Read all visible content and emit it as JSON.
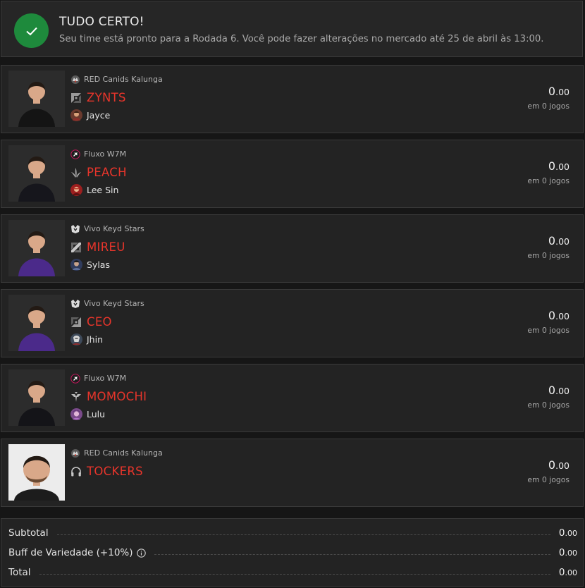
{
  "banner": {
    "title": "TUDO CERTO!",
    "message": "Seu time está pronto para a Rodada 6. Você pode fazer alterações no mercado até 25 de abril às 13:00.",
    "icon": "check-icon",
    "accent": "#1e8a3c"
  },
  "players": [
    {
      "team": "RED Canids Kalunga",
      "team_icon": "red-canids-logo",
      "position_icon": "top-lane-icon",
      "name": "ZYNTS",
      "champion": "Jayce",
      "champion_icon": "jayce-icon",
      "score_int": "0",
      "score_dec": ".00",
      "games": "em 0 jogos"
    },
    {
      "team": "Fluxo W7M",
      "team_icon": "fluxo-logo",
      "position_icon": "jungle-icon",
      "name": "PEACH",
      "champion": "Lee Sin",
      "champion_icon": "lee-sin-icon",
      "score_int": "0",
      "score_dec": ".00",
      "games": "em 0 jogos"
    },
    {
      "team": "Vivo Keyd Stars",
      "team_icon": "keyd-logo",
      "position_icon": "mid-lane-icon",
      "name": "MIREU",
      "champion": "Sylas",
      "champion_icon": "sylas-icon",
      "score_int": "0",
      "score_dec": ".00",
      "games": "em 0 jogos"
    },
    {
      "team": "Vivo Keyd Stars",
      "team_icon": "keyd-logo",
      "position_icon": "bot-lane-icon",
      "name": "CEO",
      "champion": "Jhin",
      "champion_icon": "jhin-icon",
      "score_int": "0",
      "score_dec": ".00",
      "games": "em 0 jogos"
    },
    {
      "team": "Fluxo W7M",
      "team_icon": "fluxo-logo",
      "position_icon": "support-icon",
      "name": "MOMOCHI",
      "champion": "Lulu",
      "champion_icon": "lulu-icon",
      "score_int": "0",
      "score_dec": ".00",
      "games": "em 0 jogos"
    },
    {
      "team": "RED Canids Kalunga",
      "team_icon": "red-canids-logo",
      "position_icon": "coach-headset-icon",
      "name": "TOCKERS",
      "champion": "",
      "champion_icon": "",
      "score_int": "0",
      "score_dec": ".00",
      "games": "em 0 jogos"
    }
  ],
  "totals": {
    "subtotal_label": "Subtotal",
    "subtotal_int": "0",
    "subtotal_dec": ".00",
    "buff_label": "Buff de Variedade (+10%)",
    "buff_int": "0",
    "buff_dec": ".00",
    "total_label": "Total",
    "total_int": "0",
    "total_dec": ".00"
  },
  "colors": {
    "player_name": "#e8352b",
    "card_bg": "#232323",
    "page_bg": "#161616"
  }
}
